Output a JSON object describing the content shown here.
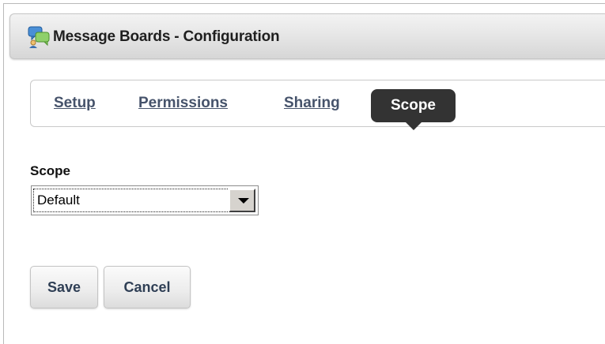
{
  "window": {
    "title": "Message Boards - Configuration",
    "icon": "message-boards-icon"
  },
  "tabs": [
    {
      "label": "Setup",
      "active": false
    },
    {
      "label": "Permissions",
      "active": false
    },
    {
      "label": "Sharing",
      "active": false
    },
    {
      "label": "Scope",
      "active": true
    }
  ],
  "form": {
    "scope_label": "Scope",
    "scope_value": "Default"
  },
  "buttons": {
    "save_label": "Save",
    "cancel_label": "Cancel"
  },
  "colors": {
    "active_tab_bg": "#333333",
    "tab_link": "#46536b",
    "button_text": "#2f3f55"
  }
}
